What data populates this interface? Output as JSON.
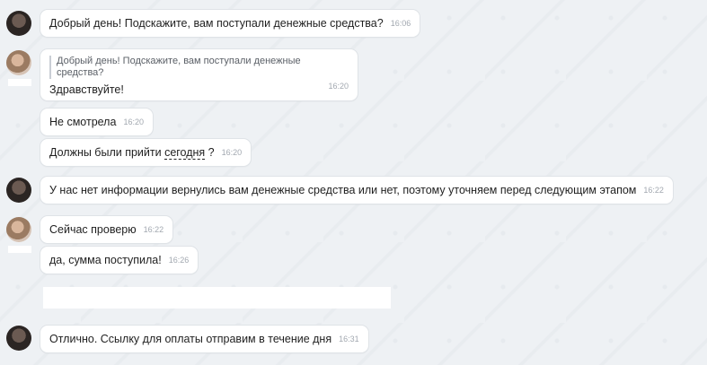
{
  "messages": [
    {
      "text": "Добрый день! Подскажите, вам поступали денежные средства?",
      "time": "16:06"
    },
    {
      "quote": "Добрый день! Подскажите, вам поступали денежные средства?",
      "text": "Здравствуйте!",
      "time": "16:20"
    },
    {
      "text": "Не смотрела",
      "time": "16:20"
    },
    {
      "text_before": "Должны были прийти ",
      "text_underlined": "сегодня",
      "text_after": " ?",
      "time": "16:20"
    },
    {
      "text": "У нас нет информации вернулись вам денежные средства или нет, поэтому уточняем перед следующим этапом",
      "time": "16:22"
    },
    {
      "text": "Сейчас проверю",
      "time": "16:22"
    },
    {
      "text": "да, сумма поступила!",
      "time": "16:26"
    },
    {
      "text": "Отлично. Ссылку для оплаты отправим в течение дня",
      "time": "16:31"
    }
  ]
}
